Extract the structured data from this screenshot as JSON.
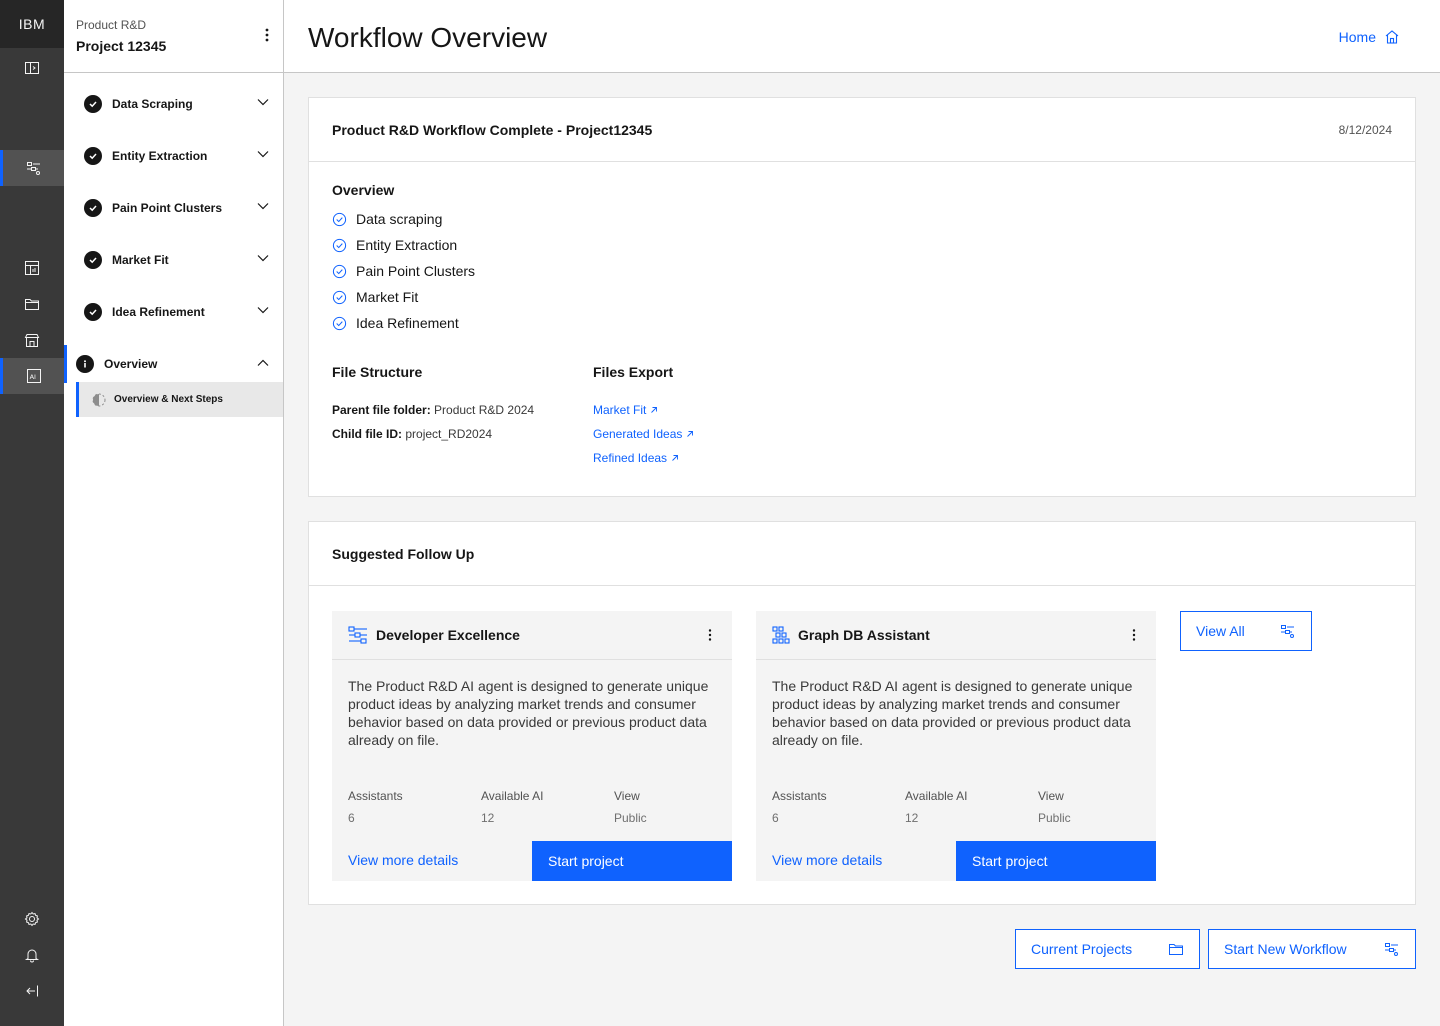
{
  "rail": {
    "brand": "IBM"
  },
  "sidenav": {
    "org": "Product R&D",
    "project": "Project 12345",
    "steps": [
      {
        "label": "Data Scraping"
      },
      {
        "label": "Entity Extraction"
      },
      {
        "label": "Pain Point Clusters"
      },
      {
        "label": "Market Fit"
      },
      {
        "label": "Idea Refinement"
      },
      {
        "label": "Overview"
      }
    ],
    "substep": "Overview & Next Steps"
  },
  "header": {
    "title": "Workflow Overview",
    "home_label": "Home"
  },
  "summary": {
    "title": "Product R&D Workflow Complete - Project12345",
    "date": "8/12/2024",
    "overview_heading": "Overview",
    "overview_items": [
      "Data scraping",
      "Entity Extraction",
      "Pain Point Clusters",
      "Market Fit",
      "Idea Refinement"
    ],
    "file_structure_heading": "File Structure",
    "parent_label": "Parent file folder:",
    "parent_value": "Product R&D 2024",
    "child_label": "Child file ID:",
    "child_value": "project_RD2024",
    "files_export_heading": "Files Export",
    "exports": [
      "Market Fit",
      "Generated Ideas",
      "Refined Ideas"
    ]
  },
  "followup": {
    "title": "Suggested Follow Up",
    "cards": [
      {
        "title": "Developer Excellence",
        "icon": "flow-icon",
        "description": "The Product R&D AI agent is designed to generate unique product ideas by analyzing market trends and consumer behavior based on data provided or previous product data already on file.",
        "assistants_label": "Assistants",
        "assistants_value": "6",
        "ai_label": "Available AI",
        "ai_value": "12",
        "view_label": "View",
        "view_value": "Public",
        "details_label": "View more details",
        "start_label": "Start project"
      },
      {
        "title": "Graph DB Assistant",
        "icon": "graph-icon",
        "description": "The Product R&D AI agent is designed to generate unique product ideas by analyzing market trends and consumer behavior based on data provided or previous product data already on file.",
        "assistants_label": "Assistants",
        "assistants_value": "6",
        "ai_label": "Available AI",
        "ai_value": "12",
        "view_label": "View",
        "view_value": "Public",
        "details_label": "View more details",
        "start_label": "Start project"
      }
    ],
    "view_all_label": "View All"
  },
  "footer": {
    "current_projects_label": "Current Projects",
    "start_workflow_label": "Start New Workflow"
  },
  "colors": {
    "accent": "#0f62fe",
    "rail": "#393939",
    "rail_brand": "#262626"
  }
}
